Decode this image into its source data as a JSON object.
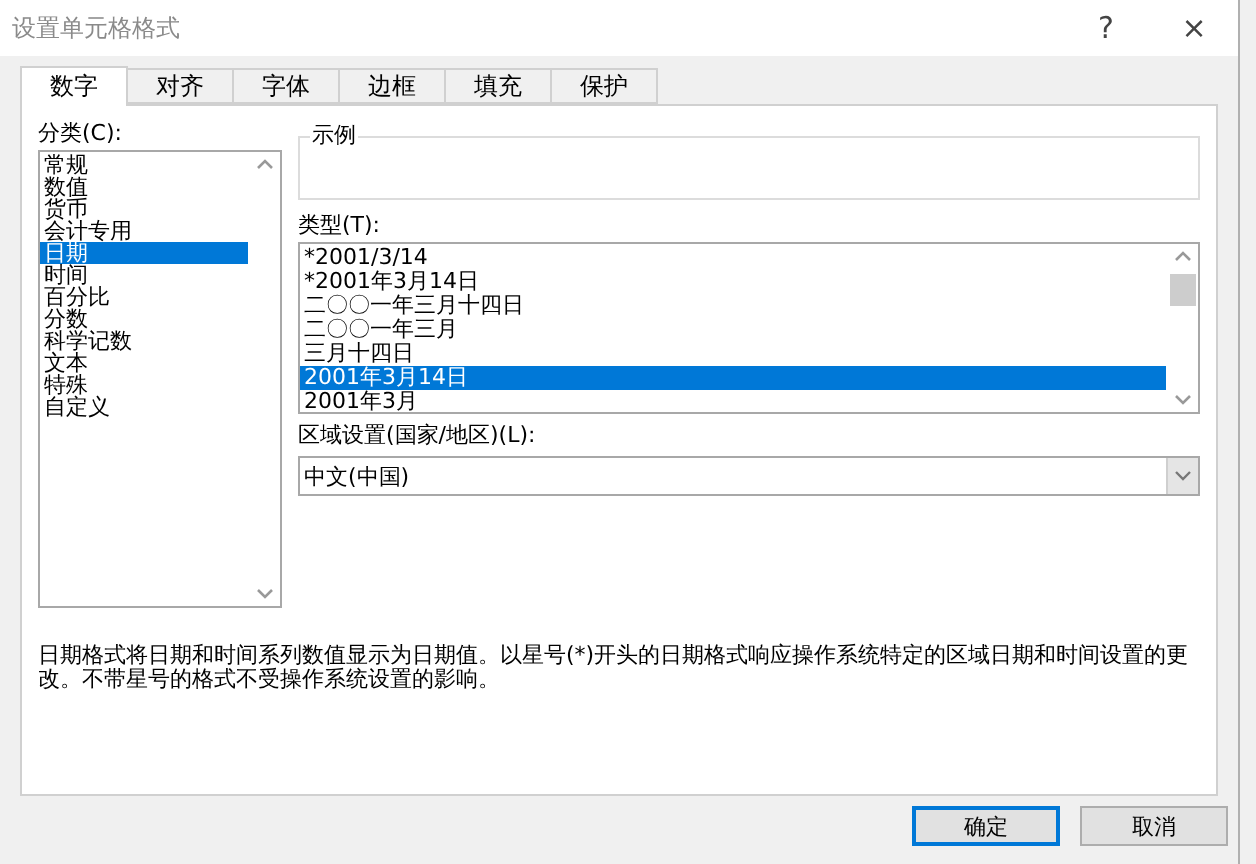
{
  "window": {
    "title": "设置单元格格式",
    "help": "?",
    "close": "×"
  },
  "tabs": [
    {
      "label": "数字",
      "selected": true
    },
    {
      "label": "对齐",
      "selected": false
    },
    {
      "label": "字体",
      "selected": false
    },
    {
      "label": "边框",
      "selected": false
    },
    {
      "label": "填充",
      "selected": false
    },
    {
      "label": "保护",
      "selected": false
    }
  ],
  "category": {
    "label": "分类(C):",
    "items": [
      {
        "label": "常规",
        "selected": false
      },
      {
        "label": "数值",
        "selected": false
      },
      {
        "label": "货币",
        "selected": false
      },
      {
        "label": "会计专用",
        "selected": false
      },
      {
        "label": "日期",
        "selected": true
      },
      {
        "label": "时间",
        "selected": false
      },
      {
        "label": "百分比",
        "selected": false
      },
      {
        "label": "分数",
        "selected": false
      },
      {
        "label": "科学记数",
        "selected": false
      },
      {
        "label": "文本",
        "selected": false
      },
      {
        "label": "特殊",
        "selected": false
      },
      {
        "label": "自定义",
        "selected": false
      }
    ]
  },
  "sample": {
    "label": "示例"
  },
  "type": {
    "label": "类型(T):",
    "items": [
      {
        "label": "*2001/3/14",
        "selected": false
      },
      {
        "label": "*2001年3月14日",
        "selected": false
      },
      {
        "label": "二〇〇一年三月十四日",
        "selected": false
      },
      {
        "label": "二〇〇一年三月",
        "selected": false
      },
      {
        "label": "三月十四日",
        "selected": false
      },
      {
        "label": "2001年3月14日",
        "selected": true
      },
      {
        "label": "2001年3月",
        "selected": false
      }
    ]
  },
  "locale": {
    "label": "区域设置(国家/地区)(L):",
    "value": "中文(中国)"
  },
  "description": "日期格式将日期和时间系列数值显示为日期值。以星号(*)开头的日期格式响应操作系统特定的区域日期和时间设置的更改。不带星号的格式不受操作系统设置的影响。",
  "buttons": [
    {
      "label": "确定",
      "kind": "default"
    },
    {
      "label": "取消",
      "kind": "normal"
    }
  ]
}
